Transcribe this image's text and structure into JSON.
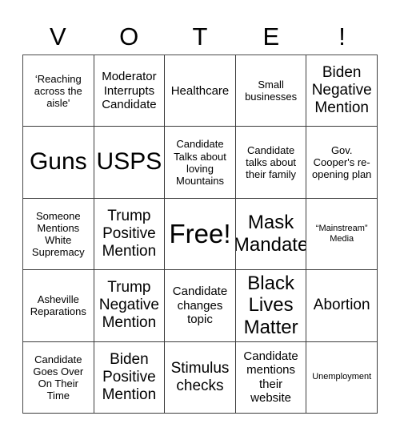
{
  "header": {
    "letters": [
      "V",
      "O",
      "T",
      "E",
      "!"
    ]
  },
  "grid": {
    "rows": 5,
    "columns": 5,
    "cells": [
      {
        "text": "‘Reaching across the aisle'",
        "size": "sm"
      },
      {
        "text": "Moderator Interrupts Candidate",
        "size": "md"
      },
      {
        "text": "Healthcare",
        "size": "md"
      },
      {
        "text": "Small businesses",
        "size": "sm"
      },
      {
        "text": "Biden Negative Mention",
        "size": "lg"
      },
      {
        "text": "Guns",
        "size": "xxl"
      },
      {
        "text": "USPS",
        "size": "xxl"
      },
      {
        "text": "Candidate Talks about loving Mountains",
        "size": "sm"
      },
      {
        "text": "Candidate talks about their family",
        "size": "sm"
      },
      {
        "text": "Gov. Cooper's re-opening plan",
        "size": "sm"
      },
      {
        "text": "Someone Mentions White Supremacy",
        "size": "sm"
      },
      {
        "text": "Trump Positive Mention",
        "size": "lg"
      },
      {
        "text": "Free!",
        "size": "free"
      },
      {
        "text": "Mask Mandate",
        "size": "xl"
      },
      {
        "text": "“Mainstream” Media",
        "size": "xs"
      },
      {
        "text": "Asheville Reparations",
        "size": "sm"
      },
      {
        "text": "Trump Negative Mention",
        "size": "lg"
      },
      {
        "text": "Candidate changes topic",
        "size": "md"
      },
      {
        "text": "Black Lives Matter",
        "size": "xl"
      },
      {
        "text": "Abortion",
        "size": "lg"
      },
      {
        "text": "Candidate Goes Over On Their Time",
        "size": "sm"
      },
      {
        "text": "Biden Positive Mention",
        "size": "lg"
      },
      {
        "text": "Stimulus checks",
        "size": "lg"
      },
      {
        "text": "Candidate mentions their website",
        "size": "md"
      },
      {
        "text": "Unemployment",
        "size": "xs"
      }
    ]
  },
  "colors": {
    "background": "#ffffff",
    "text": "#000000",
    "grid_line": "#3c3c3c"
  }
}
